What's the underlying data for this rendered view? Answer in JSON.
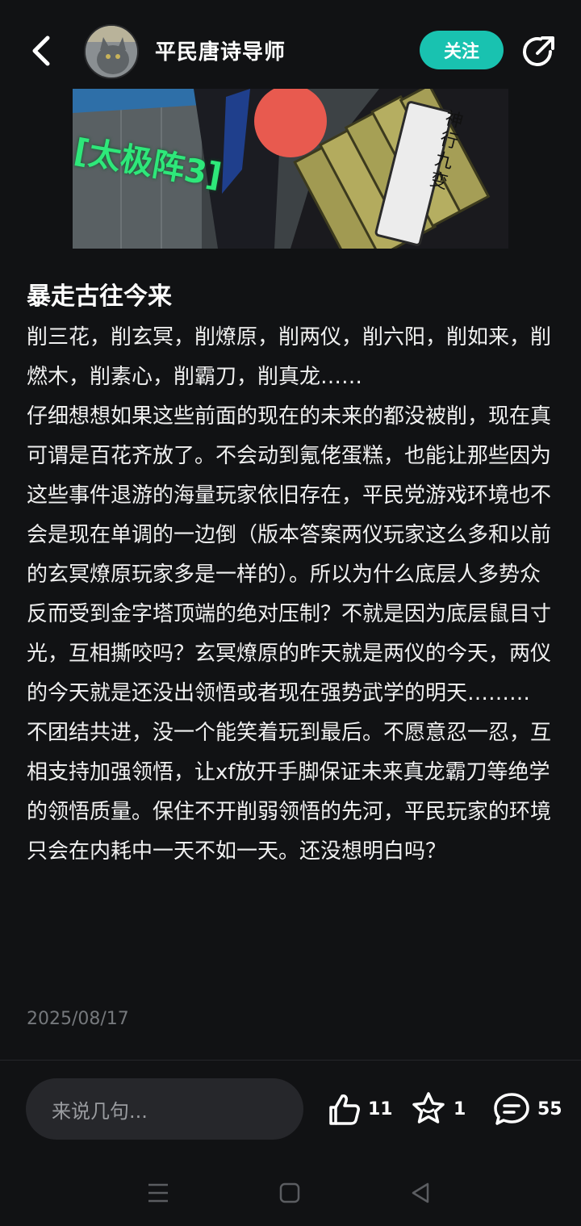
{
  "header": {
    "author_name": "平民唐诗导师",
    "follow_label": "关注"
  },
  "image": {
    "overlay_text": "[太极阵3]",
    "scroll_label": "神行九变"
  },
  "post": {
    "title": "暴走古往今来",
    "paragraphs": [
      "削三花，削玄冥，削燎原，削两仪，削六阳，削如来，削燃木，削素心，削霸刀，削真龙……",
      "仔细想想如果这些前面的现在的未来的都没被削，现在真可谓是百花齐放了。不会动到氪佬蛋糕，也能让那些因为这些事件退游的海量玩家依旧存在，平民党游戏环境也不会是现在单调的一边倒（版本答案两仪玩家这么多和以前的玄冥燎原玩家多是一样的）。所以为什么底层人多势众反而受到金字塔顶端的绝对压制？不就是因为底层鼠目寸光，互相撕咬吗？玄冥燎原的昨天就是两仪的今天，两仪的今天就是还没出领悟或者现在强势武学的明天………",
      "不团结共进，没一个能笑着玩到最后。不愿意忍一忍，互相支持加强领悟，让xf放开手脚保证未来真龙霸刀等绝学的领悟质量。保住不开削弱领悟的先河，平民玩家的环境只会在内耗中一天不如一天。还没想明白吗？"
    ],
    "date": "2025/08/17"
  },
  "bottom_bar": {
    "comment_placeholder": "来说几句...",
    "likes": "11",
    "favorites": "1",
    "comments": "55"
  },
  "colors": {
    "background": "#111214",
    "accent": "#19c2b0",
    "date_gray": "#75787c"
  },
  "icons": [
    "back-arrow-icon",
    "share-icon",
    "thumbs-up-icon",
    "star-icon",
    "comment-icon",
    "menu-icon",
    "home-icon",
    "back-triangle-icon"
  ]
}
